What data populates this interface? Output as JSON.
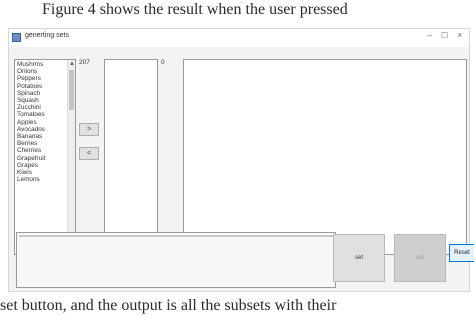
{
  "captions": {
    "top": "Figure 4 shows the result when the user pressed",
    "bottom": "set button, and the output is all the subsets with their"
  },
  "window": {
    "title": "generting sets",
    "controls": {
      "minimize": "–",
      "maximize": "☐",
      "close": "×"
    }
  },
  "items_list": [
    "Mushrms",
    "Onions",
    "Peppers",
    "Potatoes",
    "Spinach",
    "Squash",
    "Zucchini",
    "Tomatoes",
    "Apples",
    "Avocados",
    "Bananas",
    "Berries",
    "Cherries",
    "Grapefruit",
    "Grapes",
    "Kiwis",
    "Lemons"
  ],
  "counts": {
    "items": "207",
    "subsets": "0"
  },
  "buttons": {
    "move_right": ">",
    "move_left": "<",
    "set": "set",
    "disabled": "set",
    "reset": "Reset"
  },
  "scroll": {
    "up": "▲",
    "down": "▼"
  }
}
